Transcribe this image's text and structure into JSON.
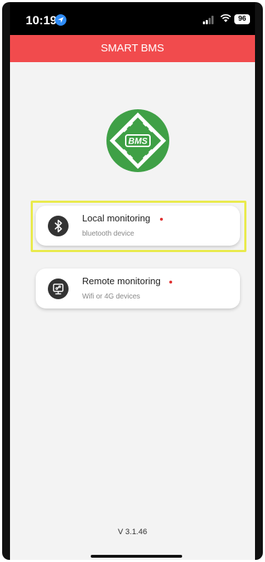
{
  "status_bar": {
    "time": "10:19",
    "battery": "96"
  },
  "app_bar": {
    "title": "SMART BMS"
  },
  "logo": {
    "text": "BMS",
    "color": "#3fa046"
  },
  "options": [
    {
      "title": "Local monitoring",
      "subtitle": "bluetooth device",
      "icon": "bluetooth-icon",
      "highlighted": true
    },
    {
      "title": "Remote monitoring",
      "subtitle": "Wifi or 4G devices",
      "icon": "remote-monitor-icon",
      "highlighted": false
    }
  ],
  "footer": {
    "version": "V 3.1.46"
  },
  "colors": {
    "accent": "#f14b4d",
    "highlight_border": "#e9ea4c",
    "status_dot": "#e03131"
  }
}
